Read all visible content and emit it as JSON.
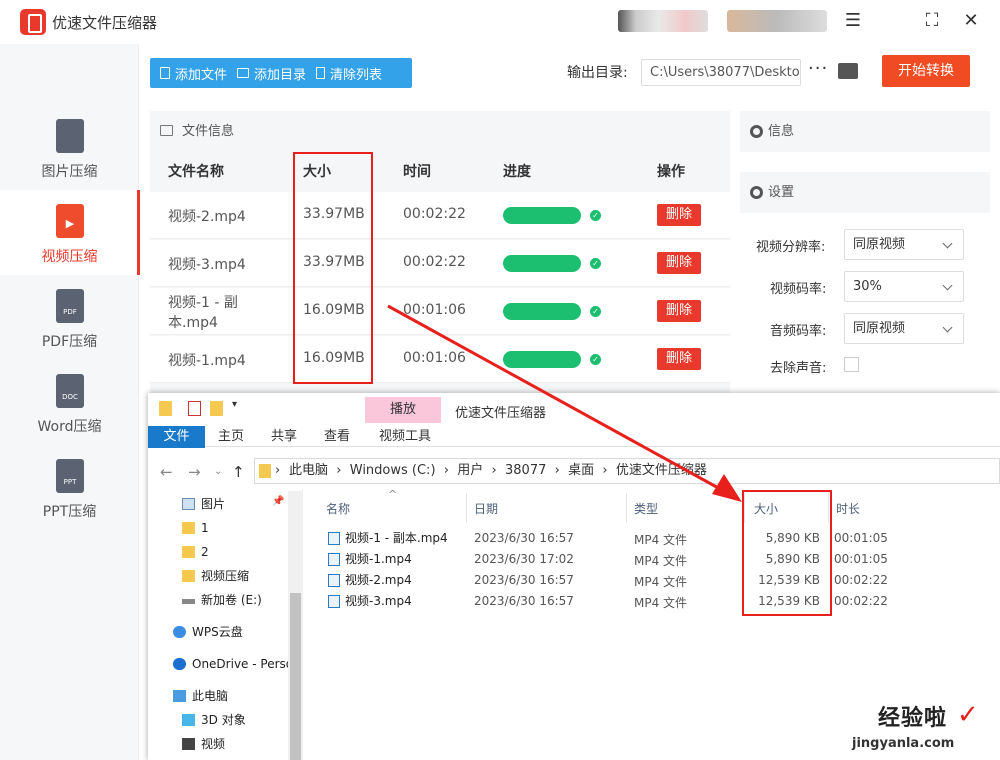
{
  "app": {
    "title": "优速文件压缩器"
  },
  "window_controls": {
    "menu": "☰",
    "maximize": "⛶",
    "close": "✕"
  },
  "sidebar": {
    "items": [
      {
        "label": "图片压缩",
        "icon_text": "",
        "active": false
      },
      {
        "label": "视频压缩",
        "icon_text": "▶",
        "active": true
      },
      {
        "label": "PDF压缩",
        "icon_text": "PDF",
        "active": false
      },
      {
        "label": "Word压缩",
        "icon_text": "DOC",
        "active": false
      },
      {
        "label": "PPT压缩",
        "icon_text": "PPT",
        "active": false
      }
    ]
  },
  "toolbar": {
    "add_file": "添加文件",
    "add_dir": "添加目录",
    "clear_list": "清除列表"
  },
  "output": {
    "label": "输出目录:",
    "path": "C:\\Users\\38077\\Deskto",
    "more": "···",
    "start": "开始转换"
  },
  "file_panel": {
    "title": "文件信息",
    "columns": {
      "name": "文件名称",
      "size": "大小",
      "time": "时间",
      "progress": "进度",
      "action": "操作"
    },
    "rows": [
      {
        "name": "视频-2.mp4",
        "size": "33.97MB",
        "time": "00:02:22",
        "progress": 1.0,
        "action": "删除"
      },
      {
        "name": "视频-3.mp4",
        "size": "33.97MB",
        "time": "00:02:22",
        "progress": 1.0,
        "action": "删除"
      },
      {
        "name": "视频-1 - 副本.mp4",
        "size": "16.09MB",
        "time": "00:01:06",
        "progress": 1.0,
        "action": "删除"
      },
      {
        "name": "视频-1.mp4",
        "size": "16.09MB",
        "time": "00:01:06",
        "progress": 1.0,
        "action": "删除"
      }
    ]
  },
  "info_panel": {
    "title": "信息"
  },
  "settings": {
    "title": "设置",
    "resolution_label": "视频分辨率:",
    "resolution_value": "同原视频",
    "bitrate_label": "视频码率:",
    "bitrate_value": "30%",
    "audio_label": "音频码率:",
    "audio_value": "同原视频",
    "mute_label": "去除声音:"
  },
  "explorer": {
    "play_tab": "播放",
    "title": "优速文件压缩器",
    "tabs": {
      "file": "文件",
      "home": "主页",
      "share": "共享",
      "view": "查看",
      "video_tools": "视频工具"
    },
    "breadcrumb": [
      "此电脑",
      "Windows (C:)",
      "用户",
      "38077",
      "桌面",
      "优速文件压缩器"
    ],
    "nav_tree": [
      "图片",
      "1",
      "2",
      "视频压缩",
      "新加卷 (E:)",
      "WPS云盘",
      "OneDrive - Perso",
      "此电脑",
      "3D 对象",
      "视频"
    ],
    "columns": {
      "name": "名称",
      "date": "日期",
      "type": "类型",
      "size": "大小",
      "duration": "时长"
    },
    "files": [
      {
        "name": "视频-1 - 副本.mp4",
        "date": "2023/6/30 16:57",
        "type": "MP4 文件",
        "size": "5,890 KB",
        "duration": "00:01:05"
      },
      {
        "name": "视频-1.mp4",
        "date": "2023/6/30 17:02",
        "type": "MP4 文件",
        "size": "5,890 KB",
        "duration": "00:01:05"
      },
      {
        "name": "视频-2.mp4",
        "date": "2023/6/30 16:57",
        "type": "MP4 文件",
        "size": "12,539 KB",
        "duration": "00:02:22"
      },
      {
        "name": "视频-3.mp4",
        "date": "2023/6/30 16:57",
        "type": "MP4 文件",
        "size": "12,539 KB",
        "duration": "00:02:22"
      }
    ]
  },
  "watermark": {
    "text": "经验啦",
    "check": "✓",
    "url": "jingyanla.com"
  },
  "colors": {
    "accent": "#e8392c",
    "toolbar_blue": "#33a2e8",
    "progress_green": "#1bbf6f",
    "annotation_red": "#e8201c",
    "file_tab_blue": "#1979ca"
  }
}
